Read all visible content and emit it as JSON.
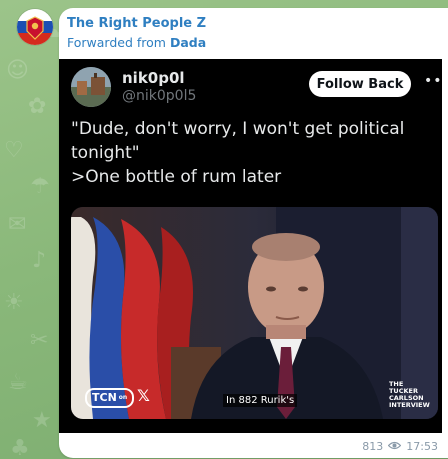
{
  "channel": {
    "name": "The Right People Z",
    "forwarded_prefix": "Forwarded from",
    "forwarded_from": "Dada"
  },
  "tweet": {
    "display_name": "nik0p0l",
    "handle": "@nik0p0l5",
    "follow_label": "Follow Back",
    "lines": [
      "\"Dude, don't worry, I won't get political",
      "tonight\"",
      ">One bottle of rum later"
    ]
  },
  "video": {
    "network_logo": "TCN",
    "network_logo_sub": "on",
    "x_logo": "𝕏",
    "caption": "In 882 Rurik's",
    "show_logo_lines": [
      "THE",
      "TUCKER",
      "CARLSON",
      "INTERVIEW"
    ]
  },
  "footer": {
    "views": "813",
    "time": "17:53"
  },
  "icons": [
    "channel-avatar-icon",
    "tweet-avatar-icon",
    "more-icon",
    "eye-icon"
  ],
  "colors": {
    "link": "#2f7fc1",
    "meta": "#8a9aa9",
    "tweet_bg": "#000000"
  }
}
